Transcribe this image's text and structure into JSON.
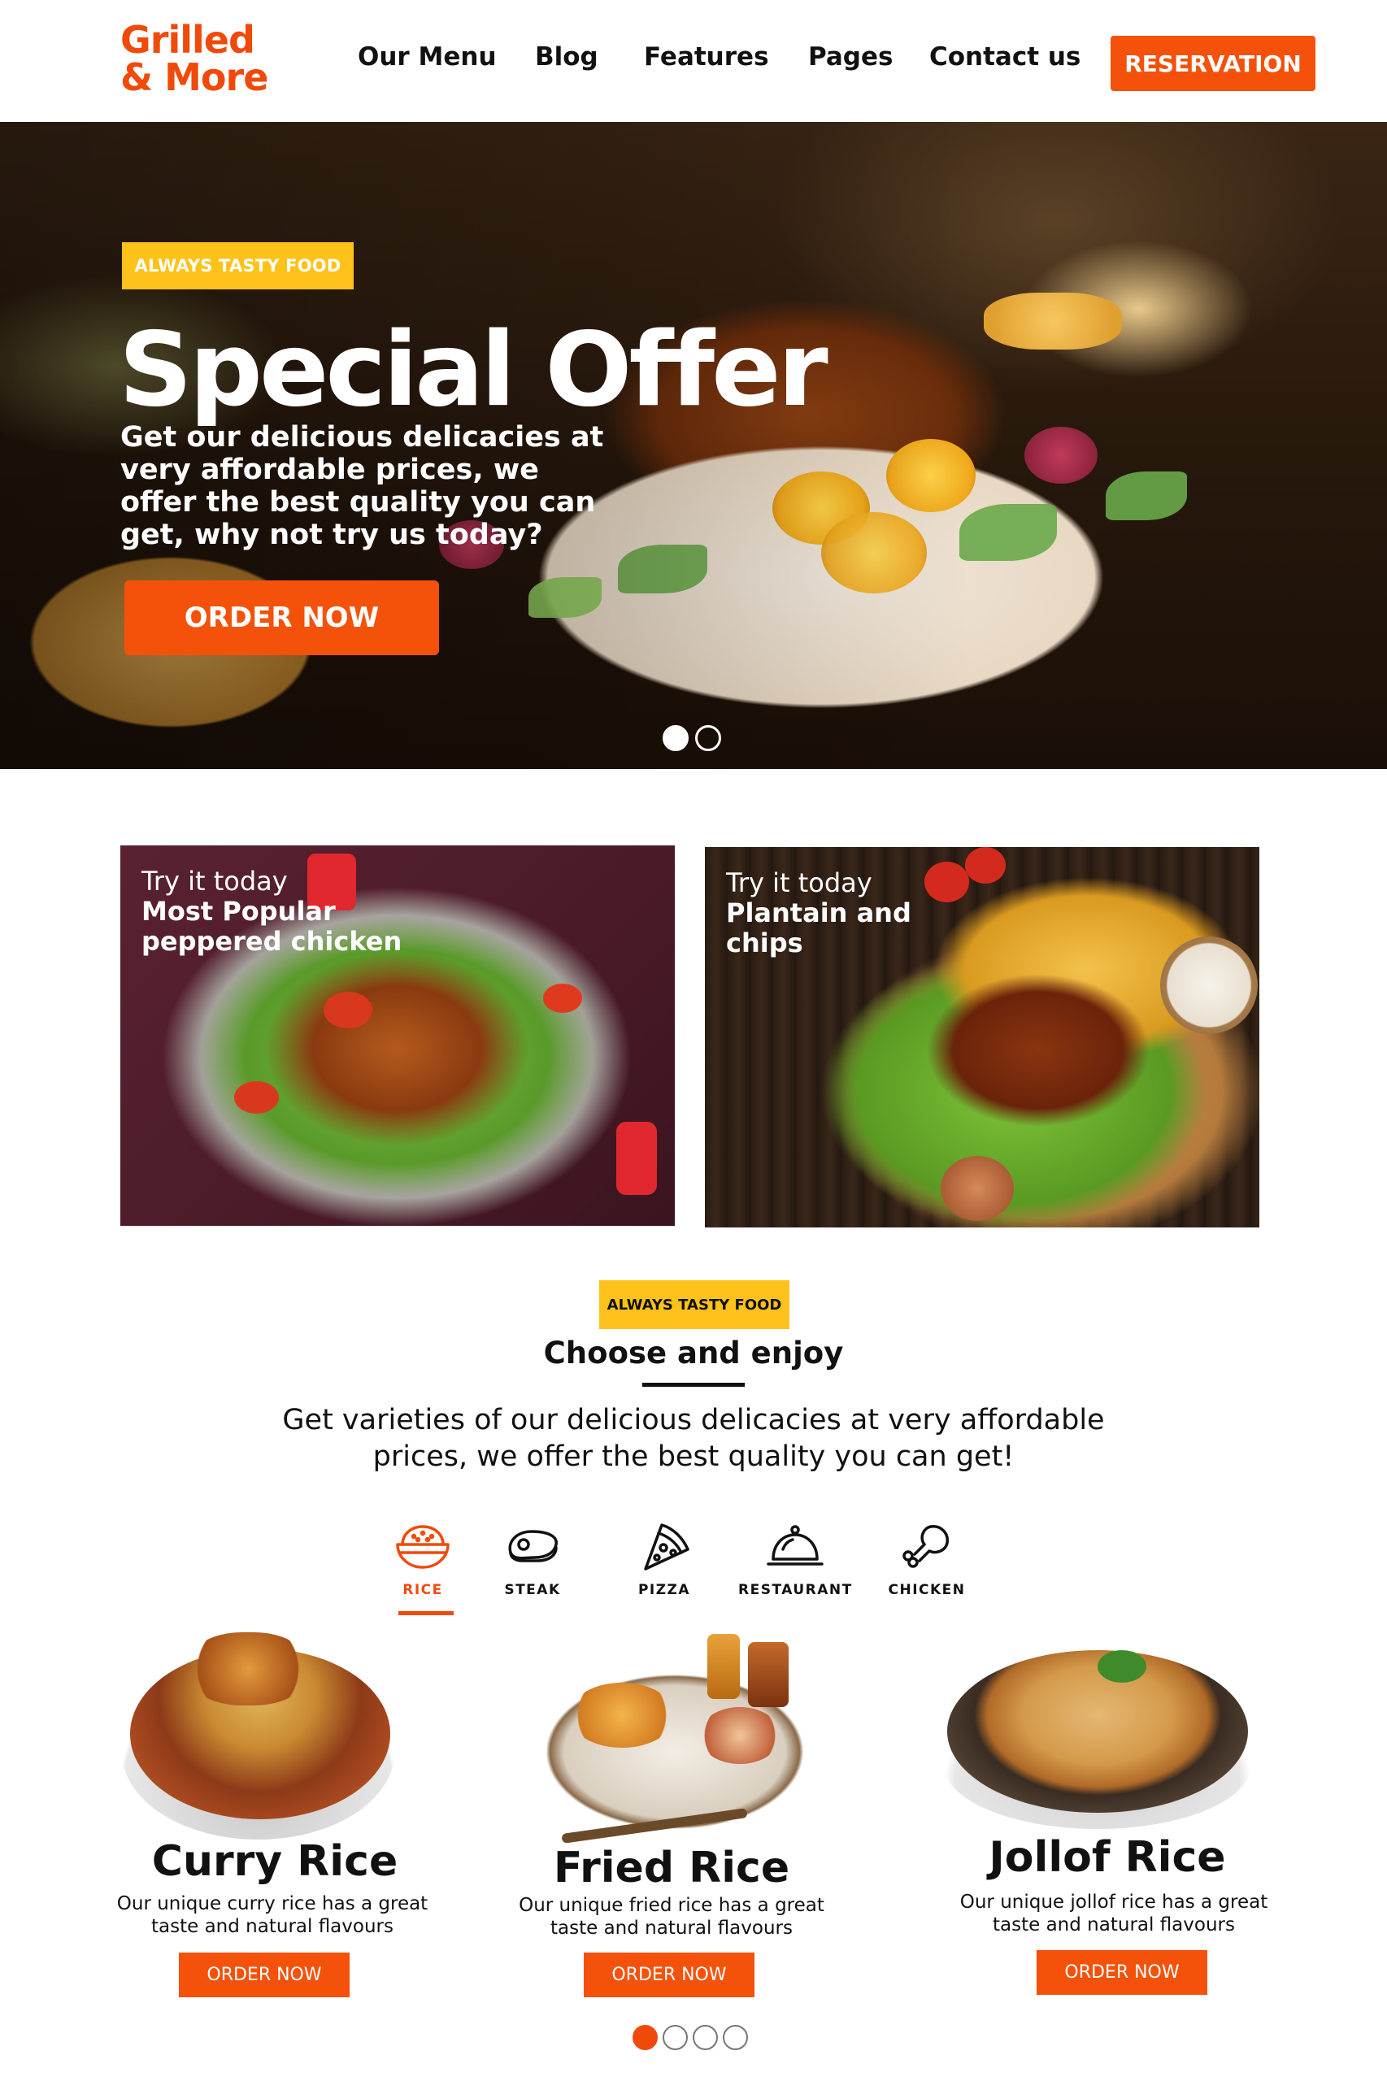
{
  "brand": {
    "line1": "Grilled",
    "line2": "& More",
    "color": "#f04a0b"
  },
  "nav": {
    "items": [
      "Our Menu",
      "Blog",
      "Features",
      "Pages",
      "Contact us"
    ],
    "cta": "RESERVATION"
  },
  "hero": {
    "tag": "ALWAYS TASTY FOOD",
    "title": "Special Offer",
    "description": "Get our delicious delicacies at very affordable prices, we offer the best quality you can get, why not try us today?",
    "button": "ORDER NOW",
    "slides": 2,
    "active_slide": 1
  },
  "promos": [
    {
      "kicker": "Try it today",
      "title_line1": "Most Popular",
      "title_line2": "peppered chicken"
    },
    {
      "kicker": "Try it today",
      "title_line1": "Plantain and",
      "title_line2": "chips"
    }
  ],
  "section": {
    "tag": "ALWAYS TASTY FOOD",
    "title": "Choose and enjoy",
    "description": "Get varieties of our delicious delicacies at very affordable prices, we offer the best quality you can get!"
  },
  "categories": [
    {
      "label": "RICE",
      "icon": "rice-bowl-icon",
      "active": true
    },
    {
      "label": "STEAK",
      "icon": "steak-icon",
      "active": false
    },
    {
      "label": "PIZZA",
      "icon": "pizza-slice-icon",
      "active": false
    },
    {
      "label": "RESTAURANT",
      "icon": "cloche-icon",
      "active": false
    },
    {
      "label": "CHICKEN",
      "icon": "chicken-leg-icon",
      "active": false
    }
  ],
  "products": [
    {
      "name": "Curry Rice",
      "description": "Our unique curry rice has a great taste and natural flavours",
      "button": "ORDER NOW"
    },
    {
      "name": "Fried Rice",
      "description": "Our unique fried rice has a great taste and natural flavours",
      "button": "ORDER NOW"
    },
    {
      "name": "Jollof Rice",
      "description": "Our unique jollof rice has a great taste and natural flavours",
      "button": "ORDER NOW"
    }
  ],
  "product_pagination": {
    "pages": 4,
    "active_page": 1
  },
  "colors": {
    "accent": "#f4510b",
    "tag": "#ffc21a",
    "text": "#111111"
  }
}
